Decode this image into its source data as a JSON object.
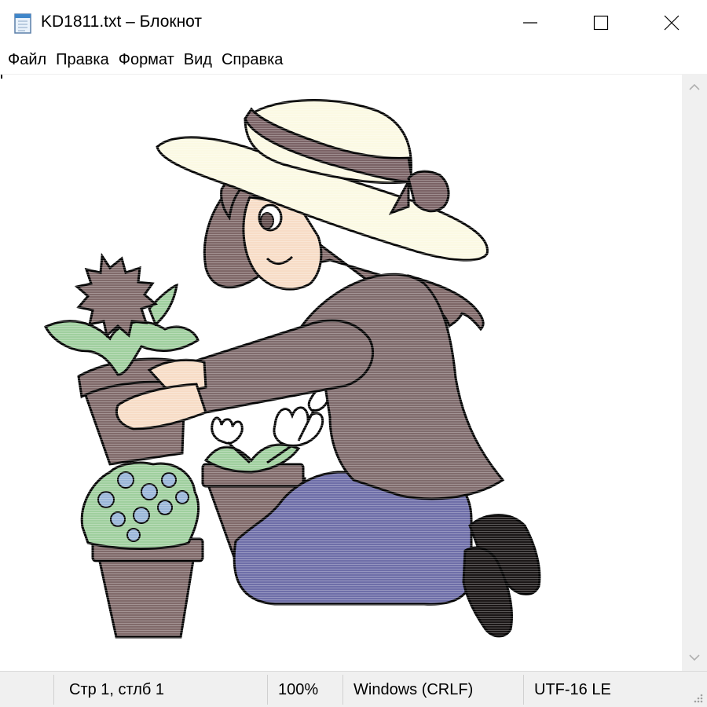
{
  "window": {
    "title": "KD1811.txt – Блокнот"
  },
  "menu": {
    "items": [
      {
        "label": "Файл"
      },
      {
        "label": "Правка"
      },
      {
        "label": "Формат"
      },
      {
        "label": "Вид"
      },
      {
        "label": "Справка"
      }
    ]
  },
  "statusbar": {
    "position": "Стр 1, стлб 1",
    "zoom": "100%",
    "line_endings": "Windows (CRLF)",
    "encoding": "UTF-16 LE"
  },
  "colors": {
    "hat_brim": "#fbf9e3",
    "hat_band": "#7a6265",
    "hair": "#7e6767",
    "skin": "#f7dcc6",
    "shirt": "#7f6b6c",
    "pants": "#6e6ea8",
    "boots": "#1a1616",
    "pot": "#806a6a",
    "leaf": "#9fcf9e",
    "flower_blue": "#9ab6d8",
    "outline": "#000000"
  },
  "icons": {
    "app": "notepad-icon",
    "minimize": "minimize-icon",
    "maximize": "maximize-icon",
    "close": "close-icon",
    "scroll_up": "chevron-up-icon",
    "scroll_down": "chevron-down-icon",
    "resize": "resize-grip-icon"
  }
}
